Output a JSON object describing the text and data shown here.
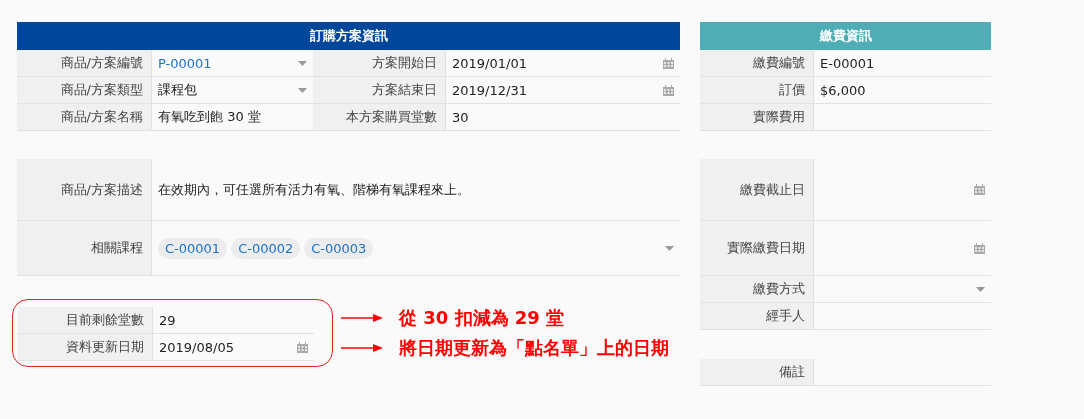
{
  "plan": {
    "title": "訂購方案資訊",
    "rows": [
      [
        {
          "label": "商品/方案編號",
          "value": "P-00001",
          "kind": "dropdown",
          "link": true
        },
        {
          "label": "方案開始日",
          "value": "2019/01/01",
          "kind": "date",
          "link": false
        }
      ],
      [
        {
          "label": "商品/方案類型",
          "value": "課程包",
          "kind": "dropdown",
          "link": false
        },
        {
          "label": "方案結束日",
          "value": "2019/12/31",
          "kind": "date",
          "link": false
        }
      ],
      [
        {
          "label": "商品/方案名稱",
          "value": "有氧吃到飽 30 堂",
          "link": false
        },
        {
          "label": "本方案購買堂數",
          "value": "30",
          "link": false
        }
      ]
    ],
    "description": {
      "label": "商品/方案描述",
      "value": "在效期內，可任選所有活力有氧、階梯有氧課程來上。"
    },
    "related_courses": {
      "label": "相關課程",
      "tags": [
        "C-00001",
        "C-00002",
        "C-00003"
      ],
      "kind": "dropdown"
    }
  },
  "status": {
    "fields": [
      {
        "label": "目前剩餘堂數",
        "value": "29"
      },
      {
        "label": "資料更新日期",
        "value": "2019/08/05",
        "kind": "date"
      }
    ]
  },
  "annotations": [
    "從 30 扣減為 29 堂",
    "將日期更新為「點名單」上的日期"
  ],
  "payment": {
    "title": "繳費資訊",
    "top_fields": [
      {
        "label": "繳費編號",
        "value": "E-00001"
      },
      {
        "label": "訂價",
        "value": "$6,000"
      },
      {
        "label": "實際費用"
      }
    ],
    "date_fields": [
      {
        "label": "繳費截止日",
        "kind": "date"
      },
      {
        "label": "實際繳費日期",
        "kind": "date"
      }
    ],
    "more_fields": [
      {
        "label": "繳費方式",
        "kind": "dropdown"
      },
      {
        "label": "經手人"
      }
    ],
    "note_field": {
      "label": "備註"
    }
  }
}
